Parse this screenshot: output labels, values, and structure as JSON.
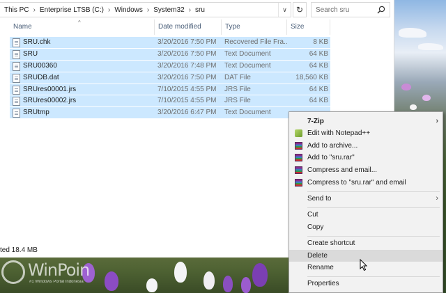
{
  "breadcrumb": [
    "This PC",
    "Enterprise LTSB (C:)",
    "Windows",
    "System32",
    "sru"
  ],
  "search": {
    "placeholder": "Search sru"
  },
  "columns": {
    "name": "Name",
    "date": "Date modified",
    "type": "Type",
    "size": "Size"
  },
  "files": [
    {
      "name": "SRU.chk",
      "date": "3/20/2016 7:50 PM",
      "type": "Recovered File Fra...",
      "size": "8 KB"
    },
    {
      "name": "SRU",
      "date": "3/20/2016 7:50 PM",
      "type": "Text Document",
      "size": "64 KB"
    },
    {
      "name": "SRU00360",
      "date": "3/20/2016 7:48 PM",
      "type": "Text Document",
      "size": "64 KB"
    },
    {
      "name": "SRUDB.dat",
      "date": "3/20/2016 7:50 PM",
      "type": "DAT File",
      "size": "18,560 KB"
    },
    {
      "name": "SRUres00001.jrs",
      "date": "7/10/2015 4:55 PM",
      "type": "JRS File",
      "size": "64 KB"
    },
    {
      "name": "SRUres00002.jrs",
      "date": "7/10/2015 4:55 PM",
      "type": "JRS File",
      "size": "64 KB"
    },
    {
      "name": "SRUtmp",
      "date": "3/20/2016 6:47 PM",
      "type": "Text Document",
      "size": ""
    }
  ],
  "status": {
    "text": "ted  18.4 MB"
  },
  "watermark": {
    "brand": "WinPoin",
    "tagline": "#1 Windows Portal Indonesia"
  },
  "context_menu": {
    "items": [
      {
        "label": "7-Zip",
        "bold": true,
        "submenu": true
      },
      {
        "label": "Edit with Notepad++",
        "icon": "notepad-plus-plus-icon"
      },
      {
        "label": "Add to archive...",
        "icon": "winrar-icon"
      },
      {
        "label": "Add to \"sru.rar\"",
        "icon": "winrar-icon"
      },
      {
        "label": "Compress and email...",
        "icon": "winrar-icon"
      },
      {
        "label": "Compress to \"sru.rar\" and email",
        "icon": "winrar-icon"
      },
      {
        "label": "Send to",
        "submenu": true
      },
      {
        "label": "Cut"
      },
      {
        "label": "Copy"
      },
      {
        "label": "Create shortcut"
      },
      {
        "label": "Delete",
        "highlighted": true
      },
      {
        "label": "Rename"
      },
      {
        "label": "Properties"
      }
    ]
  },
  "colors": {
    "selection": "#cce8ff",
    "menu_bg": "#f2f2f2",
    "menu_hover": "#dadada",
    "header_text": "#4c607a"
  }
}
